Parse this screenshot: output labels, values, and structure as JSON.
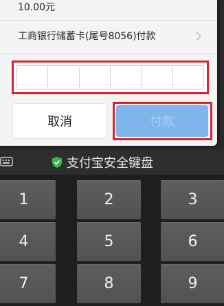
{
  "dialog": {
    "amount": "10.00元",
    "payment_method": "工商银行储蓄卡(尾号8056)付款",
    "password_cells": 6,
    "cancel_label": "取消",
    "pay_label": "付款"
  },
  "keyboard": {
    "title": "支付宝安全键盘",
    "keys": [
      "1",
      "2",
      "3",
      "4",
      "5",
      "6",
      "7",
      "8",
      "9"
    ]
  },
  "colors": {
    "highlight": "#d8242b",
    "pay_button": "#7eb6ec",
    "shield": "#39b54a"
  }
}
